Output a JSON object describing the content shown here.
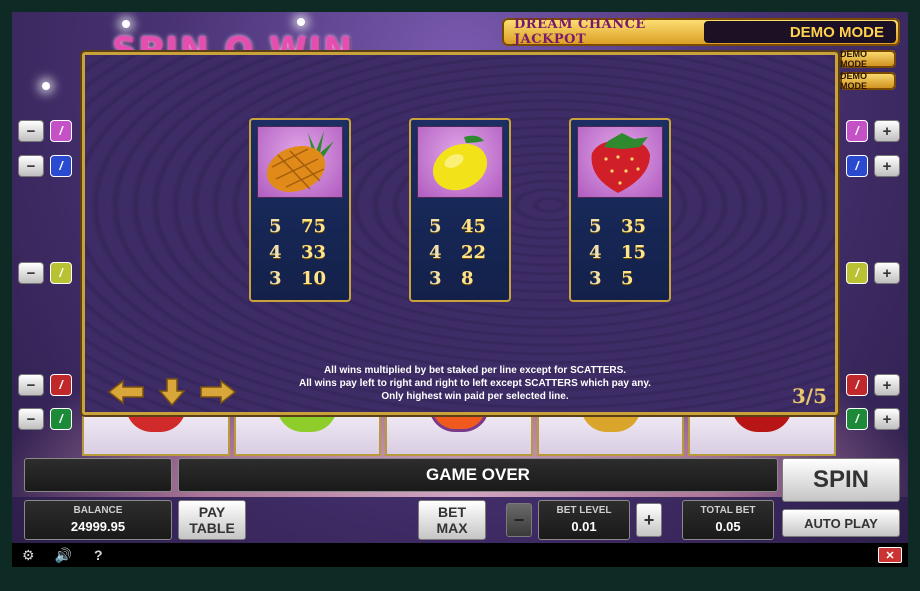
{
  "logo": {
    "text": "SPIN O WIN"
  },
  "jackpot": {
    "label": "DREAM CHANCE JACKPOT",
    "value": "DEMO MODE",
    "mini_values": [
      "DEMO MODE",
      "DEMO MODE"
    ]
  },
  "paylines": {
    "left": [
      {
        "minus": "−",
        "num": "/",
        "color": "#c452c6"
      },
      {
        "minus": "−",
        "num": "/",
        "color": "#2a4bd0"
      },
      {
        "minus": "−",
        "num": "/",
        "color": "#b8c233"
      },
      {
        "minus": "−",
        "num": "/",
        "color": "#c0282b"
      },
      {
        "minus": "−",
        "num": "/",
        "color": "#1d8a3a"
      }
    ],
    "right": [
      {
        "plus": "+",
        "num": "/",
        "color": "#c452c6"
      },
      {
        "plus": "+",
        "num": "/",
        "color": "#2a4bd0"
      },
      {
        "plus": "+",
        "num": "/",
        "color": "#b8c233"
      },
      {
        "plus": "+",
        "num": "/",
        "color": "#c0282b"
      },
      {
        "plus": "+",
        "num": "/",
        "color": "#1d8a3a"
      }
    ]
  },
  "paytable": {
    "symbols": [
      {
        "name": "pineapple",
        "icon": "pineapple-icon",
        "pays": [
          [
            "5",
            "75"
          ],
          [
            "4",
            "33"
          ],
          [
            "3",
            "10"
          ]
        ]
      },
      {
        "name": "lemon",
        "icon": "lemon-icon",
        "pays": [
          [
            "5",
            "45"
          ],
          [
            "4",
            "22"
          ],
          [
            "3",
            "8"
          ]
        ]
      },
      {
        "name": "strawberry",
        "icon": "strawberry-icon",
        "pays": [
          [
            "5",
            "35"
          ],
          [
            "4",
            "15"
          ],
          [
            "3",
            "5"
          ]
        ]
      }
    ],
    "rules": [
      "All wins multiplied by bet staked per line except for SCATTERS.",
      "All wins pay left to right and right to left except SCATTERS which pay any.",
      "Only highest win paid per selected line."
    ],
    "page": "3/5",
    "nav": {
      "prev": "left-arrow-icon",
      "close": "down-arrow-icon",
      "next": "right-arrow-icon"
    }
  },
  "controls": {
    "message": "GAME OVER",
    "balance_label": "BALANCE",
    "balance_value": "24999.95",
    "pay_table_line1": "PAY",
    "pay_table_line2": "TABLE",
    "bet_max_line1": "BET",
    "bet_max_line2": "MAX",
    "bet_level_minus": "−",
    "bet_level_label": "BET LEVEL",
    "bet_level_value": "0.01",
    "bet_level_plus": "+",
    "total_bet_label": "TOTAL BET",
    "total_bet_value": "0.05",
    "spin": "SPIN",
    "auto_play": "AUTO PLAY"
  },
  "toolbar": {
    "settings": "gear-icon",
    "sound": "speaker-icon",
    "help": "?",
    "close": "✕"
  }
}
